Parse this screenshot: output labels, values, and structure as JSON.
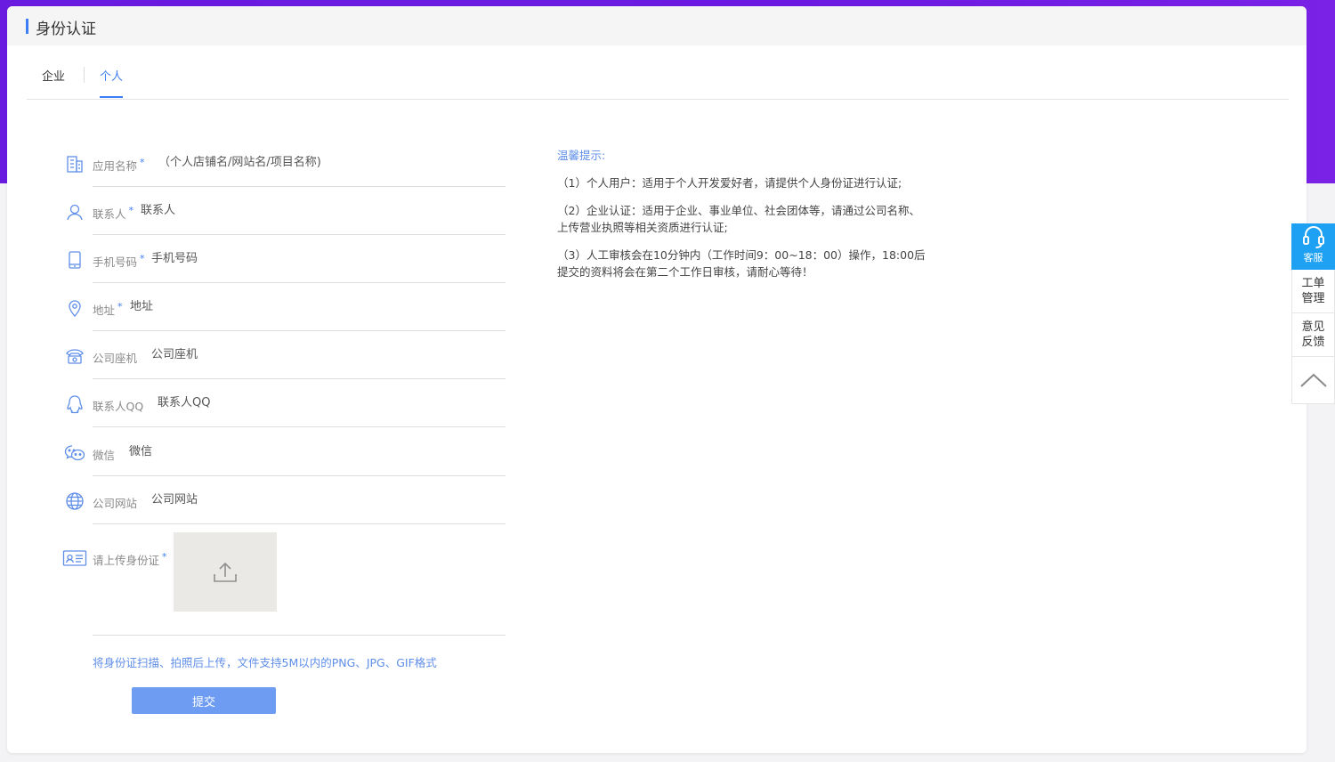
{
  "page": {
    "title": "身份认证"
  },
  "tabs": [
    {
      "label": "企业",
      "active": false
    },
    {
      "label": "个人",
      "active": true
    }
  ],
  "form": {
    "fields": [
      {
        "icon": "building-icon",
        "label": "应用名称",
        "required": true,
        "placeholder": "（个人店铺名/网站名/项目名称)"
      },
      {
        "icon": "user-icon",
        "label": "联系人",
        "required": true,
        "placeholder": "联系人"
      },
      {
        "icon": "phone-icon",
        "label": "手机号码",
        "required": true,
        "placeholder": "手机号码"
      },
      {
        "icon": "location-pin-icon",
        "label": "地址",
        "required": true,
        "placeholder": "地址"
      },
      {
        "icon": "telephone-icon",
        "label": "公司座机",
        "required": false,
        "placeholder": "公司座机"
      },
      {
        "icon": "qq-icon",
        "label": "联系人QQ",
        "required": false,
        "placeholder": "联系人QQ"
      },
      {
        "icon": "wechat-icon",
        "label": "微信",
        "required": false,
        "placeholder": "微信"
      },
      {
        "icon": "globe-icon",
        "label": "公司网站",
        "required": false,
        "placeholder": "公司网站"
      }
    ],
    "upload": {
      "icon": "id-card-icon",
      "label": "请上传身份证",
      "required": true,
      "hint": "将身份证扫描、拍照后上传，文件支持5M以内的PNG、JPG、GIF格式"
    },
    "submit_label": "提交"
  },
  "tips": {
    "title": "温馨提示:",
    "items": [
      "（1）个人用户：适用于个人开发爱好者，请提供个人身份证进行认证;",
      "（2）企业认证：适用于企业、事业单位、社会团体等，请通过公司名称、\n上传营业执照等相关资质进行认证;",
      "（3）人工审核会在10分钟内（工作时间9：00~18：00）操作，18:00后\n提交的资料将会在第二个工作日审核，请耐心等待！"
    ]
  },
  "sidebar": {
    "service_label": "客服",
    "ticket_label": "工单\n管理",
    "feedback_label": "意见\n反馈"
  },
  "colors": {
    "accent": "#3e7ef5",
    "background_band": "#6a1be0",
    "service_button": "#1ea1f2",
    "submit_button": "#6f9cf3"
  }
}
